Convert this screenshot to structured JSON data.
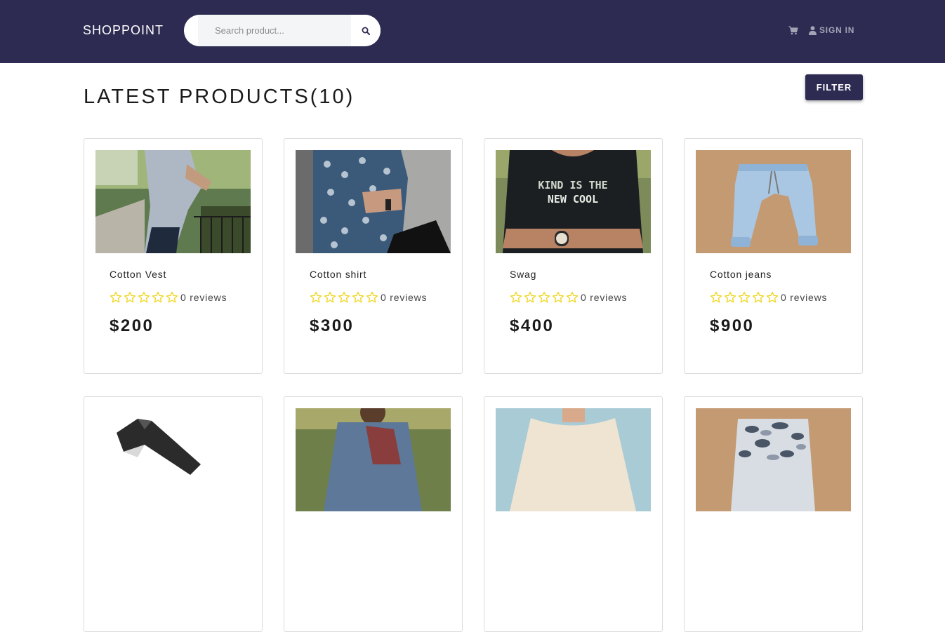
{
  "navbar": {
    "brand": "SHOPPOINT",
    "search_placeholder": "Search product...",
    "search_icon": "search-icon",
    "cart_icon": "cart-icon",
    "user_icon": "user-icon",
    "signin_label": "SIGN IN"
  },
  "main": {
    "title": "LATEST PRODUCTS(10)",
    "filter_label": "FILTER"
  },
  "colors": {
    "navbar_bg": "#2d2b52",
    "star_outline": "#f0d51a",
    "filter_bg": "#2d2b52"
  },
  "products": [
    {
      "name": "Cotton Vest",
      "reviews": "0 reviews",
      "price": "$200",
      "rating": 0,
      "image": "man in grey shirt"
    },
    {
      "name": "Cotton shirt",
      "reviews": "0 reviews",
      "price": "$300",
      "rating": 0,
      "image": "man in patterned shirt"
    },
    {
      "name": "Swag",
      "reviews": "0 reviews",
      "price": "$400",
      "rating": 0,
      "image": "black t-shirt print"
    },
    {
      "name": "Cotton jeans",
      "reviews": "0 reviews",
      "price": "$900",
      "rating": 0,
      "image": "light blue jeans"
    },
    {
      "name": "",
      "reviews": "",
      "price": "",
      "rating": 0,
      "image": "black jeans"
    },
    {
      "name": "",
      "reviews": "",
      "price": "",
      "rating": 0,
      "image": "denim vest"
    },
    {
      "name": "",
      "reviews": "",
      "price": "",
      "rating": 0,
      "image": "beige t-shirt"
    },
    {
      "name": "",
      "reviews": "",
      "price": "",
      "rating": 0,
      "image": "camo pants"
    }
  ]
}
